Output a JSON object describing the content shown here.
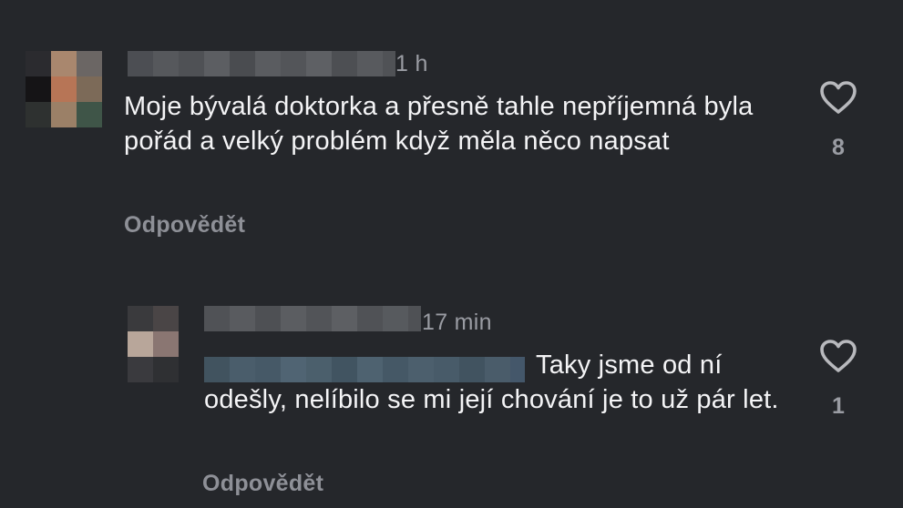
{
  "comments": [
    {
      "time": "1 h",
      "text": "Moje bývalá doktorka a přesně tahle nepříjemná byla pořád a velký problém když měla něco napsat",
      "reply_label": "Odpovědět",
      "likes": "8",
      "like_icon": "heart-outline-icon"
    },
    {
      "time": "17 min",
      "text": "Taky jsme od ní odešly, nelíbilo se mi její chování je to už pár let.",
      "reply_label": "Odpovědět",
      "likes": "1",
      "like_icon": "heart-outline-icon"
    }
  ],
  "colors": {
    "background": "#25272b",
    "text": "#f4f4f6",
    "muted": "#9a9ca3",
    "reply": "#8e9097",
    "heart": "#b8b9bd"
  }
}
